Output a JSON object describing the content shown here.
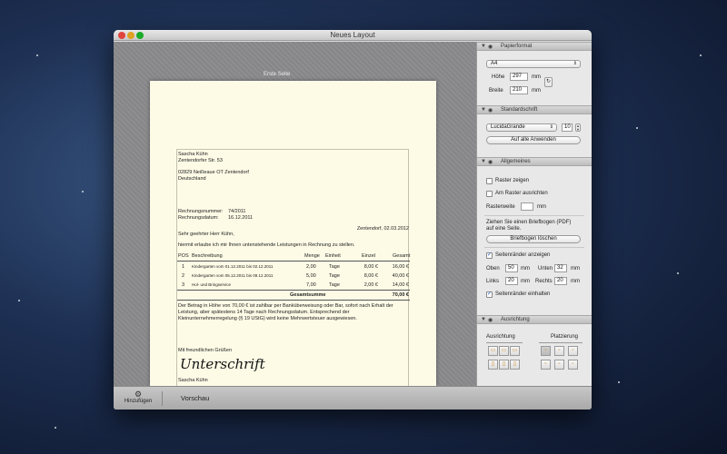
{
  "window": {
    "title": "Neues Layout"
  },
  "canvas": {
    "page_label": "Erste Seite",
    "document": {
      "sender_name": "Sascha Kühn",
      "sender_street": "Zentendorfer Str. 53",
      "recipient_city": "02829 Neißeaue OT Zentendorf",
      "recipient_country": "Deutschland",
      "invoice_number_label": "Rechnungsnummer:",
      "invoice_number": "74/2011",
      "invoice_date_label": "Rechnungsdatum:",
      "invoice_date": "16.12.2011",
      "place_date": "Zentendorf, 02.03.2012",
      "salutation": "Sehr geehrter Herr Kühn,",
      "intro": "hiermit erlaube ich mir Ihnen untenstehende Leistungen in Rechnung zu stellen.",
      "table_headers": {
        "pos": "POS",
        "desc": "Beschreibung",
        "qty": "Menge",
        "unit": "Einheit",
        "single": "Einzel",
        "total": "Gesamt"
      },
      "rows": [
        {
          "pos": "1",
          "desc": "Kindergarten vom 01.12.2011 bis 02.12.2011",
          "qty": "2,00",
          "unit": "Tage",
          "single": "8,00 €",
          "total": "16,00 €"
        },
        {
          "pos": "2",
          "desc": "Kindergarten vom 05.12.2011 bis 09.12.2011",
          "qty": "5,00",
          "unit": "Tage",
          "single": "8,00 €",
          "total": "40,00 €"
        },
        {
          "pos": "3",
          "desc": "Hol- und Bringservice",
          "qty": "7,00",
          "unit": "Tage",
          "single": "2,00 €",
          "total": "14,00 €"
        }
      ],
      "sum_label": "Gesamtsumme",
      "sum_value": "70,00 €",
      "note_line1": "Der Betrag in Höhe von 70,00 € ist zahlbar per Banküberweisung oder Bar, sofort nach Erhalt der",
      "note_line2": "Leistung, aber spätestens 14 Tage nach Rechnungsdatum. Entsprechend der",
      "note_line3": "Kleinunternehmerregelung (§ 19 UStG) wird keine Mehrwertsteuer ausgewiesen.",
      "closing": "Mit freundlichen Grüßen",
      "signature": "Unterschrift",
      "signer": "Sascha Kühn"
    }
  },
  "bottombar": {
    "add_label": "Hinzufügen",
    "preview_label": "Vorschau"
  },
  "inspector": {
    "paper": {
      "title": "Papierformat",
      "format": "A4",
      "height_label": "Höhe",
      "height_value": "297",
      "height_unit": "mm",
      "width_label": "Breite",
      "width_value": "210",
      "width_unit": "mm"
    },
    "font": {
      "title": "Standardschrift",
      "font_name": "LucidaGrande",
      "font_size": "10",
      "apply_all": "Auf alle Anwenden"
    },
    "general": {
      "title": "Allgemeines",
      "show_grid": "Raster zeigen",
      "snap_grid": "Am Raster ausrichten",
      "grid_width_label": "Rasterweite",
      "grid_width_value": "",
      "grid_width_unit": "mm",
      "letterhead_hint1": "Ziehen Sie einen Briefbogen (PDF)",
      "letterhead_hint2": "auf eine Seite.",
      "delete_letterhead": "Briefbogen löschen",
      "show_margins": "Seitenränder anzeigen",
      "top_label": "Oben",
      "top_value": "50",
      "bottom_label": "Unten",
      "bottom_value": "32",
      "left_label": "Links",
      "left_value": "20",
      "right_label": "Rechts",
      "right_value": "20",
      "mm": "mm",
      "keep_margins": "Seitenränder einhalten"
    },
    "alignment": {
      "title": "Ausrichtung",
      "align_label": "Ausrichtung",
      "placement_label": "Platzierung"
    }
  },
  "colors": {
    "desktop": "#1d2f52",
    "paper": "#fdfbe6",
    "canvas": "#8a8a8c",
    "check": "#1d5fd0"
  }
}
